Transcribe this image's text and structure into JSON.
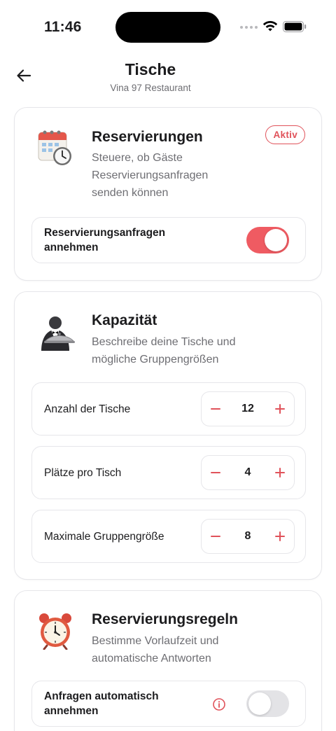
{
  "status_bar": {
    "time": "11:46"
  },
  "header": {
    "title": "Tische",
    "subtitle": "Vina 97 Restaurant"
  },
  "colors": {
    "accent": "#ef5b62",
    "badge": "#e0525a",
    "muted_text": "#6e6e73",
    "border": "#e6e6ea"
  },
  "reservations_card": {
    "icon": "calendar-clock-icon",
    "title": "Reservierungen",
    "badge": "Aktiv",
    "description_lines": [
      "Steuere, ob Gäste",
      "Reservierungsanfragen",
      "senden können"
    ],
    "toggle_row": {
      "label_lines": [
        "Reservierungsanfragen",
        "annehmen"
      ],
      "enabled": true
    }
  },
  "capacity_card": {
    "icon": "waiter-icon",
    "title": "Kapazität",
    "description_lines": [
      "Beschreibe deine Tische und",
      "mögliche Gruppengrößen"
    ],
    "rows": [
      {
        "label": "Anzahl der Tische",
        "value": "12"
      },
      {
        "label": "Plätze pro Tisch",
        "value": "4"
      },
      {
        "label": "Maximale Gruppengröße",
        "value": "8"
      }
    ]
  },
  "rules_card": {
    "icon": "alarm-clock-icon",
    "title": "Reservierungsregeln",
    "description_lines": [
      "Bestimme Vorlaufzeit und",
      "automatische Antworten"
    ],
    "toggle_row": {
      "label_lines": [
        "Anfragen automatisch",
        "annehmen"
      ],
      "enabled": false,
      "info_icon": "info-icon"
    }
  }
}
